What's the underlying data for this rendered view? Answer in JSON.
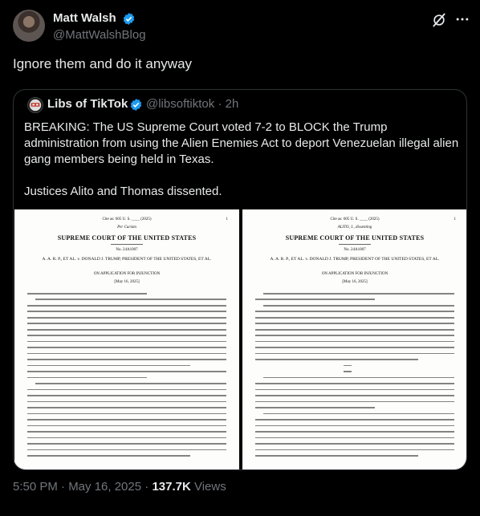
{
  "author": {
    "name": "Matt Walsh",
    "handle": "@MattWalshBlog"
  },
  "tweet": {
    "text": "Ignore them and do it anyway"
  },
  "quoted": {
    "name": "Libs of TikTok",
    "handle": "@libsoftiktok",
    "separator": "·",
    "time": "2h",
    "paragraph1": "BREAKING: The US Supreme Court voted 7-2 to BLOCK the Trump administration from using the Alien Enemies Act to deport Venezuelan illegal alien gang members being held in Texas.",
    "paragraph2": "Justices Alito and Thomas dissented.",
    "doc_left": {
      "cite": "Cite as: 605 U. S. ____ (2025)",
      "page": "1",
      "sub": "Per Curiam",
      "court": "SUPREME COURT OF THE UNITED STATES",
      "docket": "No. 24A1007",
      "caption": "A. A. R. P., ET AL. v. DONALD J. TRUMP, PRESIDENT OF THE UNITED STATES, ET AL.",
      "application": "ON APPLICATION FOR INJUNCTION",
      "date": "[May 16, 2025]"
    },
    "doc_right": {
      "cite": "Cite as: 605 U. S. ____ (2025)",
      "page": "1",
      "sub": "ALITO, J., dissenting",
      "court": "SUPREME COURT OF THE UNITED STATES",
      "docket": "No. 24A1007",
      "caption": "A. A. R. P., ET AL. v. DONALD J. TRUMP, PRESIDENT OF THE UNITED STATES, ET AL.",
      "application": "ON APPLICATION FOR INJUNCTION",
      "date": "[May 16, 2025]"
    }
  },
  "footer": {
    "timestamp": "5:50 PM · May 16, 2025",
    "separator": "·",
    "views_count": "137.7K",
    "views_label": "Views"
  },
  "colors": {
    "background": "#000000",
    "text": "#e7e9ea",
    "muted": "#71767b",
    "border": "#2f3336",
    "verified": "#1d9bf0"
  }
}
